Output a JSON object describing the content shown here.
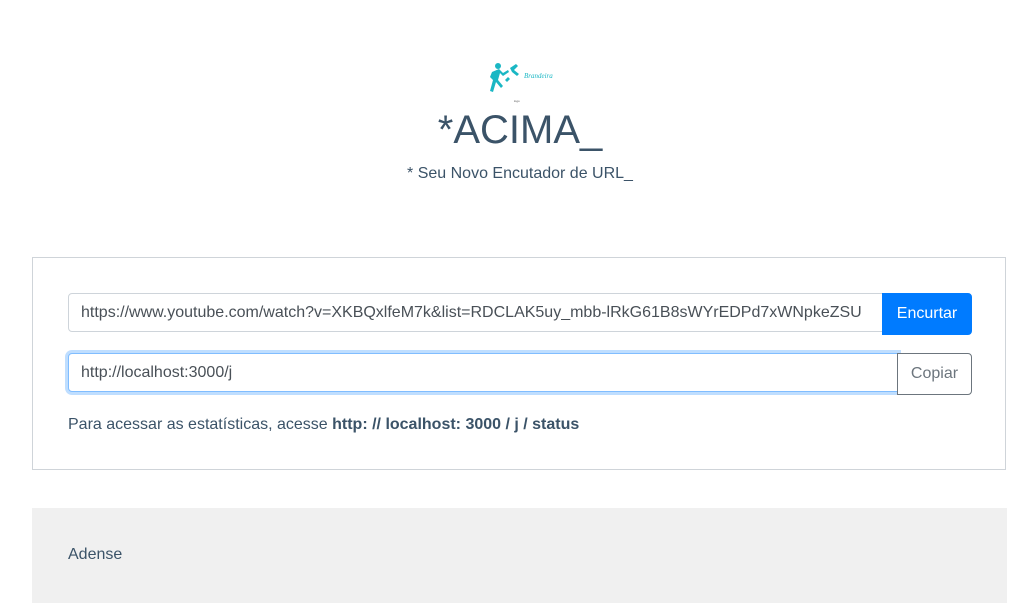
{
  "header": {
    "logo_text": "Brandeira Cristina",
    "logo_subtext": "logo",
    "title": "*ACIMA_",
    "subtitle": "* Seu Novo Encutador de URL_"
  },
  "form": {
    "url_value": "https://www.youtube.com/watch?v=XKBQxlfeM7k&list=RDCLAK5uy_mbb-lRkG61B8sWYrEDPd7xWNpkeZSU",
    "shorten_label": "Encurtar",
    "short_url_value": "http://localhost:3000/j",
    "copy_label": "Copiar",
    "stats_prefix": "Para acessar as estatísticas, acesse ",
    "stats_link": "http: // localhost: 3000 / j / status"
  },
  "ads": {
    "label": "Adense"
  },
  "colors": {
    "primary": "#007bff",
    "text": "#3b5368",
    "logo": "#1ab7c4"
  }
}
